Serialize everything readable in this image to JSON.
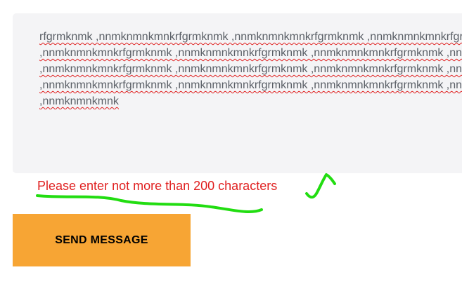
{
  "form": {
    "message_lines": [
      "rfgrmknmk ,nnmknmnkmnkrfgrmknmk ,nnmknmnkmnkrfgrmknmk ,nnmknmnkmnkrfgrmknmk",
      ",nnmknmnkmnkrfgrmknmk ,nnmknmnkmnkrfgrmknmk ,nnmknmnkmnkrfgrmknmk ,nnmknmnk",
      ",nnmknmnkmnkrfgrmknmk ,nnmknmnkmnkrfgrmknmk ,nnmknmnkmnkrfgrmknmk ,nnmknmnk",
      ",nnmknmnkmnkrfgrmknmk ,nnmknmnkmnkrfgrmknmk ,nnmknmnkmnkrfgrmknmk ,nnmknmnk",
      ",nnmknmnkmnk"
    ],
    "error_message": "Please enter not more than 200 characters",
    "send_label": "SEND MESSAGE"
  },
  "colors": {
    "textarea_background": "#f4f4f6",
    "error": "#e02020",
    "button_background": "#f7a534",
    "annotation_stroke": "#22dd11"
  }
}
